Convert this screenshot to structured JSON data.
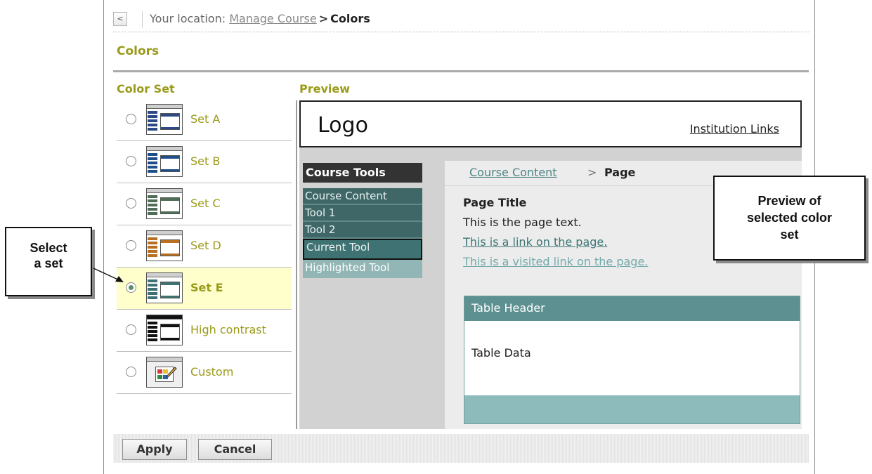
{
  "breadcrumb": {
    "back_icon": "chevron-left-icon",
    "prefix": "Your location:",
    "parent": "Manage Course",
    "separator": ">",
    "current": "Colors"
  },
  "page": {
    "title": "Colors",
    "colorset_heading": "Color Set",
    "preview_heading": "Preview"
  },
  "color_sets": [
    {
      "label": "Set A",
      "selected": false,
      "side_color": "#2c4a86"
    },
    {
      "label": "Set B",
      "selected": false,
      "side_color": "#1f4f8a"
    },
    {
      "label": "Set C",
      "selected": false,
      "side_color": "#4f6e55"
    },
    {
      "label": "Set D",
      "selected": false,
      "side_color": "#b86f22"
    },
    {
      "label": "Set E",
      "selected": true,
      "side_color": "#3f7272"
    },
    {
      "label": "High contrast",
      "selected": false,
      "side_color": "#111111"
    },
    {
      "label": "Custom",
      "selected": false,
      "icon": "palette-icon"
    }
  ],
  "preview": {
    "logo": "Logo",
    "institution_links": "Institution Links",
    "course_tools_title": "Course Tools",
    "tools": [
      {
        "label": "Course Content",
        "state": "normal"
      },
      {
        "label": "Tool 1",
        "state": "normal"
      },
      {
        "label": "Tool 2",
        "state": "normal"
      },
      {
        "label": "Current Tool",
        "state": "current"
      },
      {
        "label": "Highlighted Tool",
        "state": "highlight"
      }
    ],
    "crumb_link": "Course Content",
    "crumb_sep": ">",
    "crumb_current": "Page",
    "page_title": "Page Title",
    "page_text": "This is the page text.",
    "link_text": "This is a link on the page.",
    "visited_link_text": "This is a visited link on the page.",
    "table_header": "Table Header",
    "table_data": "Table Data"
  },
  "buttons": {
    "apply": "Apply",
    "cancel": "Cancel"
  },
  "callouts": {
    "select_line1": "Select",
    "select_line2": "a set",
    "preview_line1": "Preview of",
    "preview_line2": "selected color",
    "preview_line3": "set"
  },
  "colors": {
    "accent": "#9a9a1a",
    "selected_row_bg": "#ffffcc",
    "tool_bg": "#3f6767",
    "table_header_bg": "#5d9090"
  }
}
